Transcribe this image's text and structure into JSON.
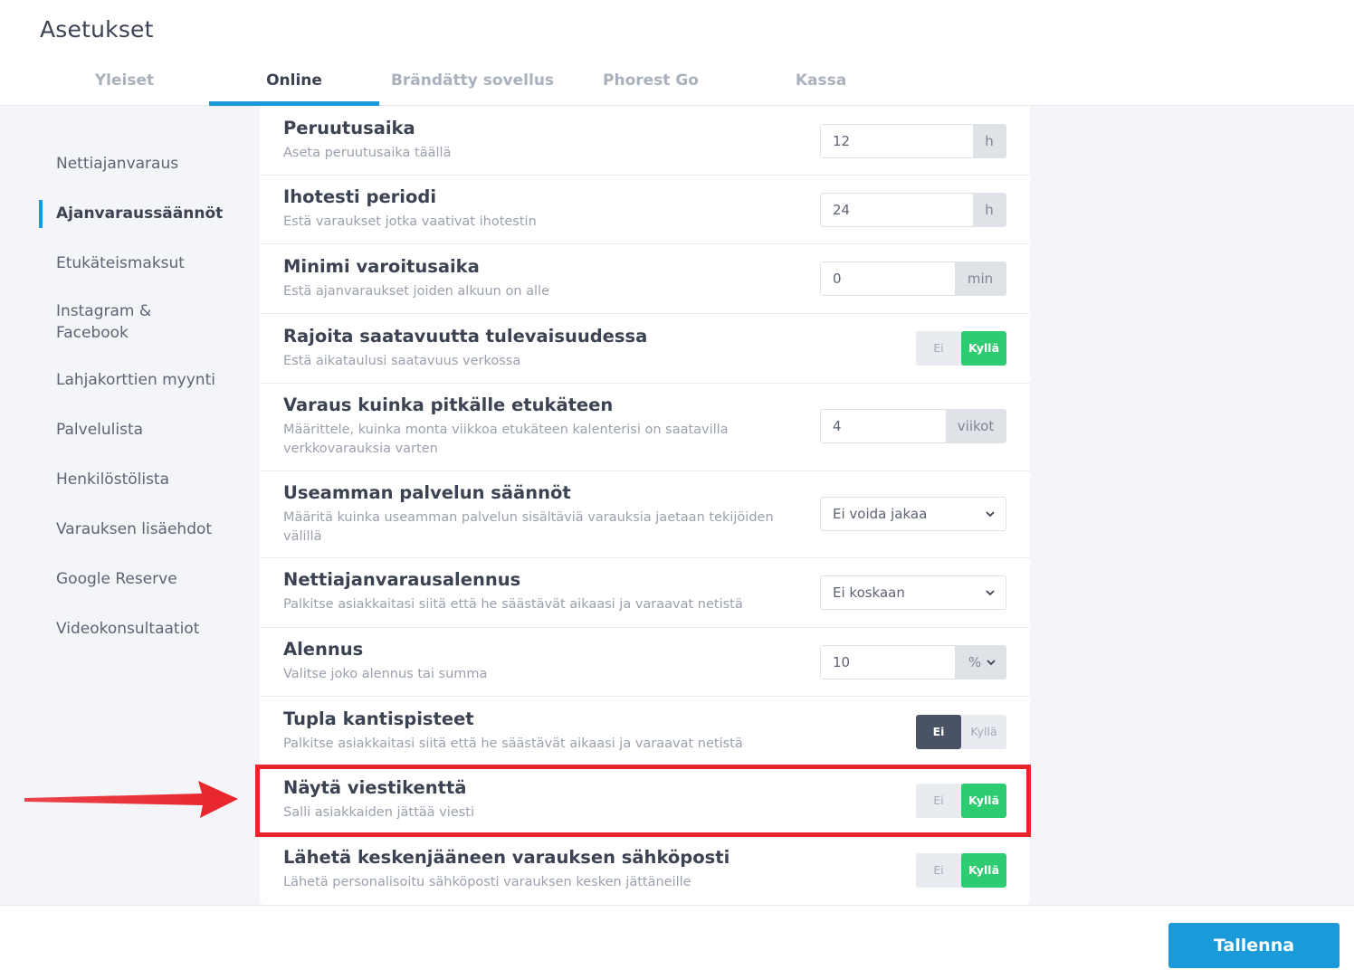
{
  "page": {
    "title": "Asetukset"
  },
  "tabs": [
    {
      "label": "Yleiset"
    },
    {
      "label": "Online"
    },
    {
      "label": "Brändätty sovellus"
    },
    {
      "label": "Phorest Go"
    },
    {
      "label": "Kassa"
    }
  ],
  "active_tab": "Online",
  "sidebar": {
    "items": [
      {
        "label": "Nettiajanvaraus"
      },
      {
        "label": "Ajanvaraussäännöt"
      },
      {
        "label": "Etukäteismaksut"
      },
      {
        "label": "Instagram & Facebook"
      },
      {
        "label": "Lahjakorttien myynti"
      },
      {
        "label": "Palvelulista"
      },
      {
        "label": "Henkilöstölista"
      },
      {
        "label": "Varauksen lisäehdot"
      },
      {
        "label": "Google Reserve"
      },
      {
        "label": "Videokonsultaatiot"
      }
    ],
    "active_item": "Ajanvaraussäännöt"
  },
  "settings": [
    {
      "title": "Peruutusaika",
      "description": "Aseta peruutusaika täällä",
      "value": "12",
      "unit": "h"
    },
    {
      "title": "Ihotesti periodi",
      "description": "Estä varaukset jotka vaativat ihotestin",
      "value": "24",
      "unit": "h"
    },
    {
      "title": "Minimi varoitusaika",
      "description": "Estä ajanvaraukset joiden alkuun on alle",
      "value": "0",
      "unit": "min"
    },
    {
      "title": "Rajoita saatavuutta tulevaisuudessa",
      "description": "Estä aikataulusi saatavuus verkossa",
      "toggle": {
        "off_label": "Ei",
        "on_label": "Kyllä",
        "selected": "Kyllä"
      }
    },
    {
      "title": "Varaus kuinka pitkälle etukäteen",
      "description": "Määrittele, kuinka monta viikkoa etukäteen kalenterisi on saatavilla verkkovarauksia varten",
      "value": "4",
      "unit": "viikot"
    },
    {
      "title": "Useamman palvelun säännöt",
      "description": "Määritä kuinka useamman palvelun sisältäviä varauksia jaetaan tekijöiden välillä",
      "select_value": "Ei voida jakaa"
    },
    {
      "title": "Nettiajanvarausalennus",
      "description": "Palkitse asiakkaitasi siitä että he säästävät aikaasi ja varaavat netistä",
      "select_value": "Ei koskaan"
    },
    {
      "title": "Alennus",
      "description": "Valitse joko alennus tai summa",
      "value": "10",
      "unit": "%"
    },
    {
      "title": "Tupla kantispisteet",
      "description": "Palkitse asiakkaitasi siitä että he säästävät aikaasi ja varaavat netistä",
      "toggle": {
        "off_label": "Ei",
        "on_label": "Kyllä",
        "selected": "Ei"
      }
    },
    {
      "title": "Näytä viestikenttä",
      "description": "Salli asiakkaiden jättää viesti",
      "toggle": {
        "off_label": "Ei",
        "on_label": "Kyllä",
        "selected": "Kyllä"
      }
    },
    {
      "title": "Lähetä keskenjääneen varauksen sähköposti",
      "description": "Lähetä personalisoitu sähköposti varauksen kesken jättäneille",
      "toggle": {
        "off_label": "Ei",
        "on_label": "Kyllä",
        "selected": "Kyllä"
      }
    }
  ],
  "footer": {
    "save_label": "Tallenna"
  },
  "colors": {
    "accent": "#1a9ad8",
    "toggle_on": "#2ecc71",
    "toggle_off_selected": "#4a5366",
    "highlight": "#e8242b"
  },
  "icons": {
    "select_chevron": "chevron-down-icon",
    "annotation_arrow": "arrow-right-icon"
  }
}
